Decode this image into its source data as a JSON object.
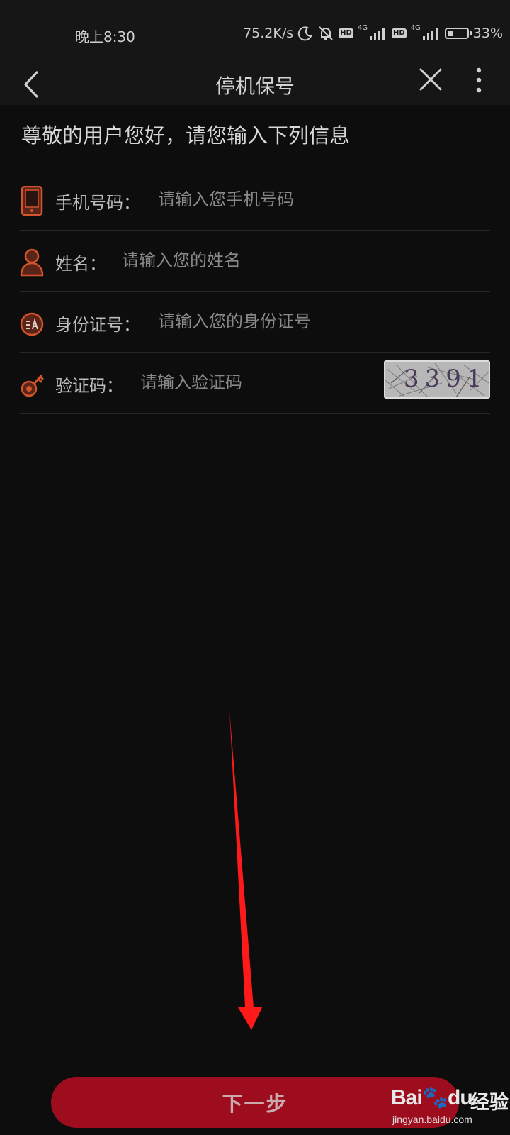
{
  "status_bar": {
    "time": "晚上8:30",
    "net_speed": "75.2K/s",
    "sim1_badge": "HD",
    "sim1_net": "4G",
    "sim2_badge": "HD",
    "sim2_net": "4G",
    "battery": "33%",
    "battery_level": 0.33,
    "icons": [
      "moon-icon",
      "mute-bell-icon",
      "signal-icon",
      "battery-icon"
    ]
  },
  "nav": {
    "title": "停机保号",
    "icons": [
      "back-arrow-icon",
      "close-icon",
      "more-vertical-icon"
    ]
  },
  "form": {
    "greeting": "尊敬的用户您好，请您输入下列信息",
    "fields": [
      {
        "label": "手机号码：",
        "placeholder": "请输入您手机号码",
        "value": "",
        "icon": "phone-icon"
      },
      {
        "label": "姓名：",
        "placeholder": "请输入您的姓名",
        "value": "",
        "icon": "user-icon"
      },
      {
        "label": "身份证号：",
        "placeholder": "请输入您的身份证号",
        "value": "",
        "icon": "id-card-icon"
      },
      {
        "label": "验证码：",
        "placeholder": "请输入验证码",
        "value": "",
        "icon": "key-icon"
      }
    ],
    "captcha_text": "3391"
  },
  "footer": {
    "next_label": "下一步"
  },
  "watermark": {
    "logo": "Baidu",
    "brand": "经验",
    "url": "jingyan.baidu.com"
  },
  "colors": {
    "background": "#0d0d0d",
    "bar": "#161616",
    "accent": "#9d0d1d",
    "icon": "#d2552b",
    "annotation_arrow": "#ff1a1a"
  }
}
